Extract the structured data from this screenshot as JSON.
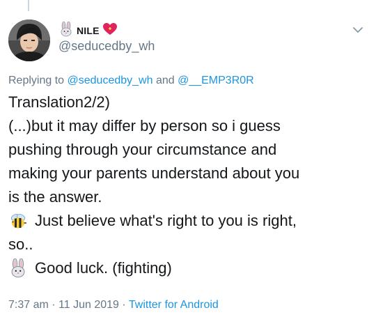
{
  "author": {
    "display_name": "NILE",
    "handle": "@seducedby_wh",
    "avatar": "avatar-photo",
    "name_emojis": [
      "rabbit-face-icon",
      "heart-icon"
    ]
  },
  "reply": {
    "prefix": "Replying to",
    "mention_1": "@seducedby_wh",
    "joiner": "and",
    "mention_2": "@__EMP3R0R"
  },
  "tweet": {
    "lines": [
      "Translation2/2)",
      "(...)but it may differ by person so i guess",
      "pushing through your circumstance and",
      "making your parents understand about you",
      "is the answer.",
      "Just believe what's right to you is right,",
      "so..",
      "Good luck. (fighting)"
    ],
    "line_6_icon": "bee-icon",
    "line_8_icon": "rabbit-face-icon"
  },
  "meta": {
    "time": "7:37 am",
    "date": "11 Jun 2019",
    "separator": "·",
    "source": "Twitter for Android"
  },
  "menu": {
    "icon": "chevron-down-icon"
  },
  "colors": {
    "text": "#14171a",
    "secondary": "#657786",
    "link": "#1b95e0",
    "heart": "#e0245e"
  }
}
